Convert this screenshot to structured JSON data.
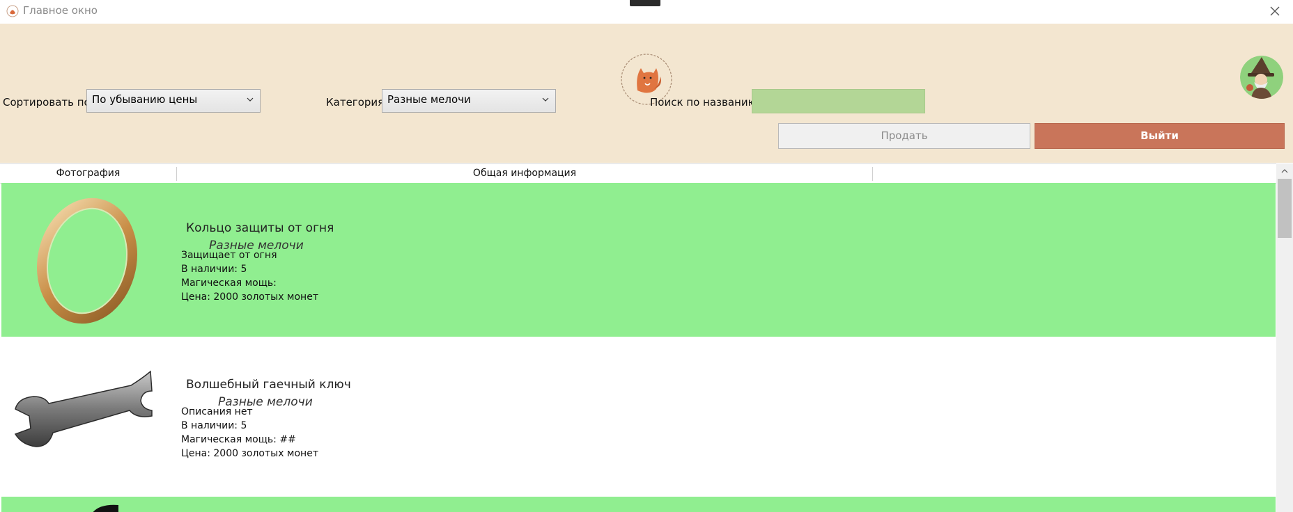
{
  "window": {
    "title": "Главное окно"
  },
  "toolbar": {
    "sort_label": "Сортировать по:",
    "sort_value": "По убыванию цены",
    "category_label": "Категория:",
    "category_value": "Разные мелочи",
    "search_label": "Поиск по названию:",
    "search_value": "",
    "sell_label": "Продать",
    "exit_label": "Выйти"
  },
  "table": {
    "columns": [
      "Фотография",
      "Общая информация",
      ""
    ],
    "rows": [
      {
        "name": "Кольцо защиты от огня",
        "category": "Разные мелочи",
        "description": "Защищает от огня",
        "stock": "В наличии: 5",
        "power": "Магическая мощь:",
        "price": "Цена: 2000 золотых монет",
        "highlighted": true,
        "photo_icon": "ring-icon"
      },
      {
        "name": "Волшебный гаечный ключ",
        "category": "Разные мелочи",
        "description": "Описания нет",
        "stock": "В наличии: 5",
        "power": "Магическая мощь: ##",
        "price": "Цена: 2000 золотых монет",
        "highlighted": false,
        "photo_icon": "wrench-icon"
      }
    ]
  },
  "colors": {
    "header_bg": "#f3e6d0",
    "row_highlight": "#90ee90",
    "search_bg": "#b3d696",
    "exit_button": "#c9755a"
  }
}
